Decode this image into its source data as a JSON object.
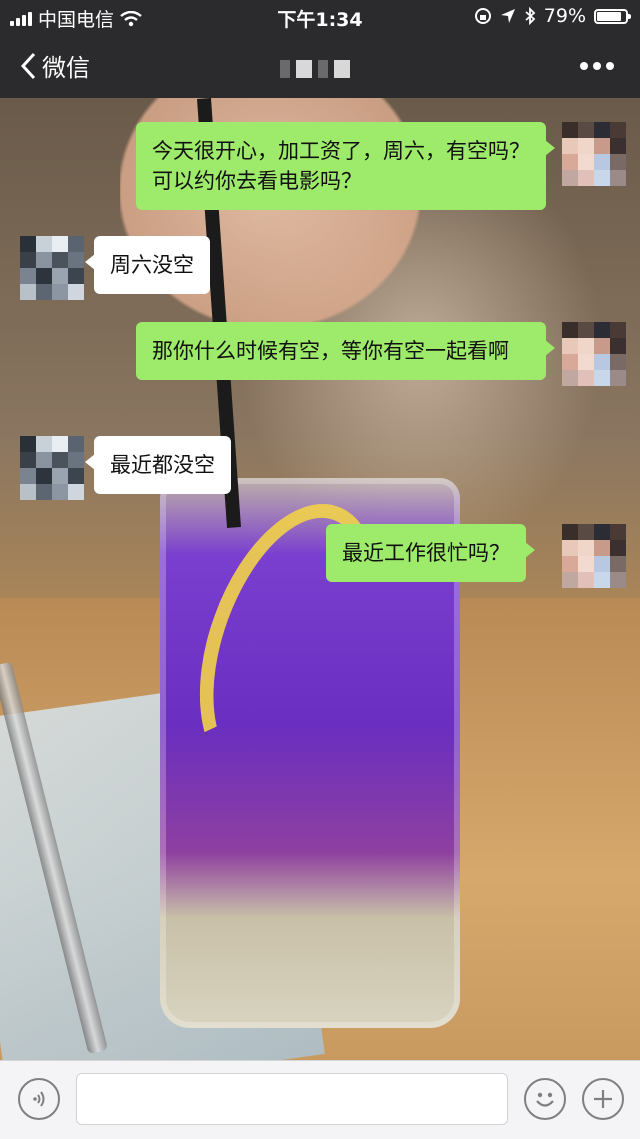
{
  "status_bar": {
    "carrier": "中国电信",
    "time": "下午1:34",
    "battery": "79%",
    "battery_level": 0.79,
    "icons": [
      "signal-icon",
      "wifi-icon",
      "lock-rotation-icon",
      "location-icon",
      "bluetooth-icon",
      "battery-icon"
    ]
  },
  "nav": {
    "back_label": "微信",
    "title_redacted": true,
    "more_icon": "more-dots-icon"
  },
  "messages": [
    {
      "sender": "me",
      "text": "今天很开心，加工资了，周六，有空吗？可以约你去看电影吗？"
    },
    {
      "sender": "other",
      "text": "周六没空"
    },
    {
      "sender": "me",
      "text": "那你什么时候有空，等你有空一起看啊"
    },
    {
      "sender": "other",
      "text": "最近都没空"
    },
    {
      "sender": "me",
      "text": "最近工作很忙吗？"
    }
  ],
  "input_bar": {
    "voice_icon": "voice-icon",
    "emoji_icon": "emoji-icon",
    "plus_icon": "plus-icon",
    "text_value": ""
  }
}
